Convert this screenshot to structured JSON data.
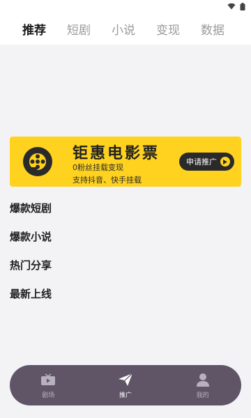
{
  "top_tabs": [
    {
      "label": "推荐",
      "active": true
    },
    {
      "label": "短剧",
      "active": false
    },
    {
      "label": "小说",
      "active": false
    },
    {
      "label": "变现",
      "active": false
    },
    {
      "label": "数据",
      "active": false
    }
  ],
  "banner": {
    "title": "钜惠电影票",
    "line1": "0粉丝挂载变现",
    "line2": "支持抖音、快手挂载",
    "button_label": "申请推广",
    "icon": "film-reel-icon",
    "background_color": "#ffd21f"
  },
  "sections": [
    {
      "title": "爆款短剧"
    },
    {
      "title": "爆款小说"
    },
    {
      "title": "热门分享"
    },
    {
      "title": "最新上线"
    }
  ],
  "bottom_nav": [
    {
      "label": "剧场",
      "icon": "tv-icon",
      "active": false
    },
    {
      "label": "推广",
      "icon": "paper-plane-icon",
      "active": true
    },
    {
      "label": "我的",
      "icon": "user-icon",
      "active": false
    }
  ],
  "colors": {
    "accent": "#ffd21f",
    "bottom_bar": "#5f5567",
    "active_tab": "#1a1a1a",
    "inactive_tab": "#9a9a9a"
  }
}
